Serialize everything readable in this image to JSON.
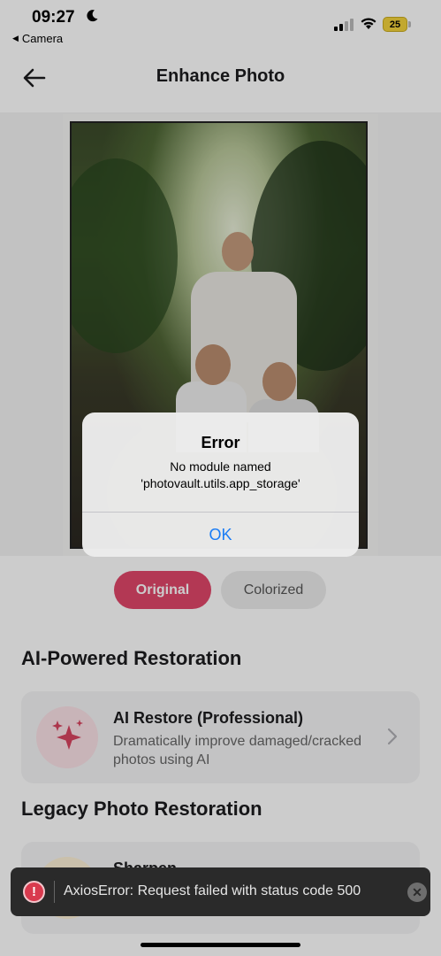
{
  "status_bar": {
    "time": "09:27",
    "back_app": "Camera",
    "battery": "25"
  },
  "nav": {
    "title": "Enhance Photo"
  },
  "toggle": {
    "original": "Original",
    "colorized": "Colorized",
    "selected": "Original"
  },
  "sections": {
    "ai_title": "AI-Powered Restoration",
    "legacy_title": "Legacy Photo Restoration"
  },
  "cards": {
    "ai_restore": {
      "title": "AI Restore (Professional)",
      "description": "Dramatically improve damaged/cracked photos using AI",
      "icon": "sparkles-icon"
    },
    "sharpen": {
      "title": "Sharpen"
    }
  },
  "alert": {
    "title": "Error",
    "message_line1": "No module named",
    "message_line2": "'photovault.utils.app_storage'",
    "ok_label": "OK"
  },
  "toast": {
    "message": "AxiosError: Request failed with status code 500",
    "icon": "error-icon"
  },
  "colors": {
    "accent": "#e0476a",
    "link": "#1a7cf5",
    "toast_bg": "#2a2a2a",
    "error": "#d93a4e"
  }
}
